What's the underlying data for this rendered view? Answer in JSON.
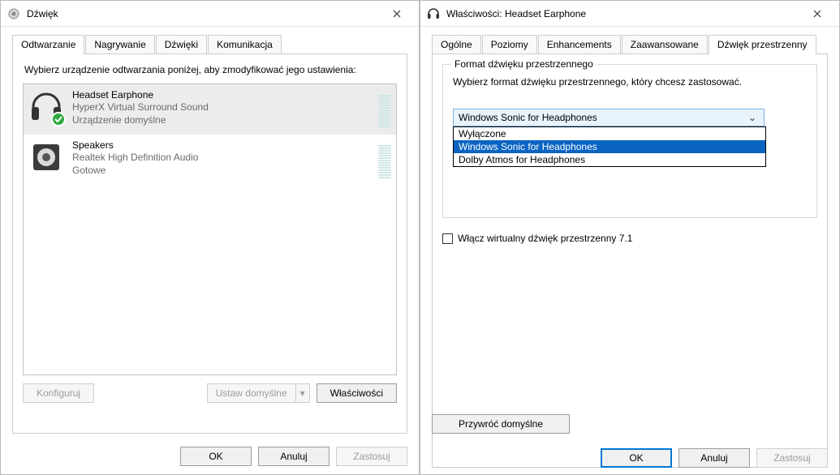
{
  "leftWindow": {
    "title": "Dźwięk",
    "tabs": {
      "playback": "Odtwarzanie",
      "recording": "Nagrywanie",
      "sounds": "Dźwięki",
      "comm": "Komunikacja"
    },
    "instruction": "Wybierz urządzenie odtwarzania poniżej, aby zmodyfikować jego ustawienia:",
    "devices": [
      {
        "name": "Headset Earphone",
        "driver": "HyperX Virtual Surround Sound",
        "status": "Urządzenie domyślne"
      },
      {
        "name": "Speakers",
        "driver": "Realtek High Definition Audio",
        "status": "Gotowe"
      }
    ],
    "buttons": {
      "configure": "Konfiguruj",
      "setDefault": "Ustaw domyślne",
      "properties": "Właściwości",
      "ok": "OK",
      "cancel": "Anuluj",
      "apply": "Zastosuj"
    }
  },
  "rightWindow": {
    "title": "Właściwości: Headset Earphone",
    "tabs": {
      "general": "Ogólne",
      "levels": "Poziomy",
      "enhancements": "Enhancements",
      "advanced": "Zaawansowane",
      "spatial": "Dźwięk przestrzenny"
    },
    "group": {
      "legend": "Format dźwięku przestrzennego",
      "desc": "Wybierz format dźwięku przestrzennego, który chcesz zastosować.",
      "selected": "Windows Sonic for Headphones",
      "options": {
        "off": "Wyłączone",
        "sonic": "Windows Sonic for Headphones",
        "dolby": "Dolby Atmos for Headphones"
      }
    },
    "checkbox": "Włącz wirtualny dźwięk przestrzenny 7.1",
    "restore": "Przywróć domyślne",
    "buttons": {
      "ok": "OK",
      "cancel": "Anuluj",
      "apply": "Zastosuj"
    }
  }
}
